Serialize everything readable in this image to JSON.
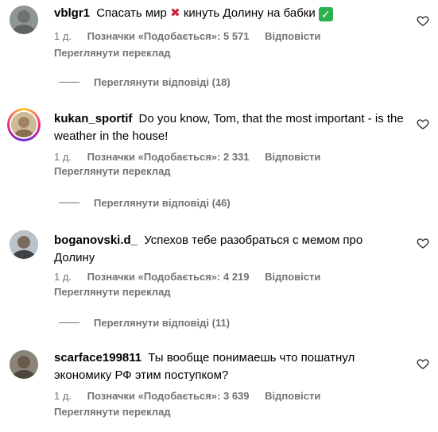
{
  "comments": [
    {
      "username": "vblgr1",
      "text_before": "Спасать мир",
      "text_mid": "кинуть Долину на бабки",
      "time": "1 д.",
      "likes": "Позначки «Подобається»: 5 571",
      "reply": "Відповісти",
      "translate": "Переглянути переклад",
      "view_replies": "Переглянути відповіді (18)"
    },
    {
      "username": "kukan_sportif",
      "text": "Do you know, Tom, that the most important - is the weather in the house!",
      "time": "1 д.",
      "likes": "Позначки «Подобається»: 2 331",
      "reply": "Відповісти",
      "translate": "Переглянути переклад",
      "view_replies": "Переглянути відповіді (46)"
    },
    {
      "username": "boganovski.d_",
      "text": "Успехов тебе разобраться с мемом про Долину",
      "time": "1 д.",
      "likes": "Позначки «Подобається»: 4 219",
      "reply": "Відповісти",
      "translate": "Переглянути переклад",
      "view_replies": "Переглянути відповіді (11)"
    },
    {
      "username": "scarface199811",
      "text": "Ты вообще понимаешь что пошатнул экономику РФ этим поступком?",
      "time": "1 д.",
      "likes": "Позначки «Подобається»: 3 639",
      "reply": "Відповісти",
      "translate": "Переглянути переклад"
    }
  ],
  "icons": {
    "like": "heart-outline-icon",
    "cross": "cross-mark-emoji",
    "check": "check-mark-button-emoji"
  },
  "colors": {
    "meta_text": "#737373",
    "cross": "#d01f3c",
    "check": "#2bb24c"
  }
}
